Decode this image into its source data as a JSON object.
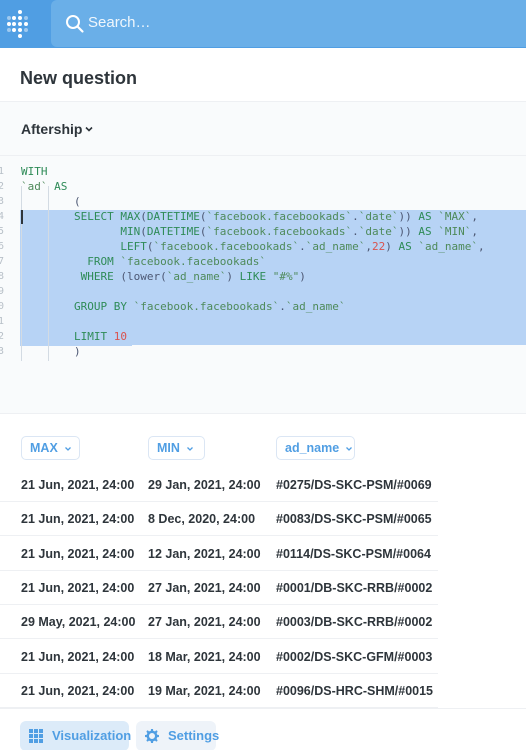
{
  "nav": {
    "search_placeholder": "Search…"
  },
  "header": {
    "title": "New question"
  },
  "database": {
    "name": "Aftership"
  },
  "editor": {
    "line_numbers": [
      "1",
      "2",
      "3",
      "4",
      "5",
      "6",
      "7",
      "8",
      "9",
      "0",
      "1",
      "2",
      "3"
    ],
    "lines": [
      "WITH",
      "`ad` AS",
      "        (",
      "        SELECT MAX(DATETIME(`facebook.facebookads`.`date`)) AS `MAX`,",
      "               MIN(DATETIME(`facebook.facebookads`.`date`)) AS `MIN`,",
      "               LEFT(`facebook.facebookads`.`ad_name`,22) AS `ad_name`,",
      "          FROM `facebook.facebookads`",
      "         WHERE (lower(`ad_name`) LIKE \"#%\")",
      "",
      "        GROUP BY `facebook.facebookads`.`ad_name`",
      "",
      "        LIMIT 10",
      "        )"
    ]
  },
  "table": {
    "columns": [
      "MAX",
      "MIN",
      "ad_name"
    ],
    "rows": [
      [
        "21 Jun, 2021, 24:00",
        "29 Jan, 2021, 24:00",
        "#0275/DS-SKC-PSM/#0069"
      ],
      [
        "21 Jun, 2021, 24:00",
        "8 Dec, 2020, 24:00",
        "#0083/DS-SKC-PSM/#0065"
      ],
      [
        "21 Jun, 2021, 24:00",
        "12 Jan, 2021, 24:00",
        "#0114/DS-SKC-PSM/#0064"
      ],
      [
        "21 Jun, 2021, 24:00",
        "27 Jan, 2021, 24:00",
        "#0001/DB-SKC-RRB/#0002"
      ],
      [
        "29 May, 2021, 24:00",
        "27 Jan, 2021, 24:00",
        "#0003/DB-SKC-RRB/#0002"
      ],
      [
        "21 Jun, 2021, 24:00",
        "18 Mar, 2021, 24:00",
        "#0002/DS-SKC-GFM/#0003"
      ],
      [
        "21 Jun, 2021, 24:00",
        "19 Mar, 2021, 24:00",
        "#0096/DS-HRC-SHM/#0015"
      ]
    ]
  },
  "footer": {
    "visualization_label": "Visualization",
    "settings_label": "Settings"
  },
  "colors": {
    "brand": "#509ee3",
    "selection": "#b7d3f5",
    "keyword": "#2e8b57",
    "number": "#d9534f"
  }
}
